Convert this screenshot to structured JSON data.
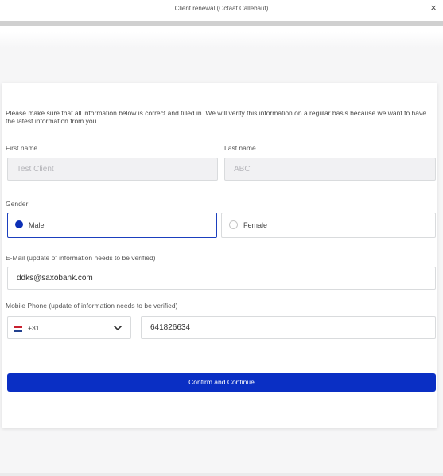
{
  "window": {
    "title": "Client renewal (Octaaf Callebaut)",
    "close_icon": "×"
  },
  "form": {
    "intro": "Please make sure that all information below is correct and filled in. We will verify this information on a regular basis because we want to have the latest information from you.",
    "first_name_label": "First name",
    "first_name_value": "Test Client",
    "last_name_label": "Last name",
    "last_name_value": "ABC",
    "gender_label": "Gender",
    "gender_options": [
      {
        "label": "Male",
        "selected": true
      },
      {
        "label": "Female",
        "selected": false
      }
    ],
    "email_label": "E-Mail (update of information needs to be verified)",
    "email_value": "ddks@saxobank.com",
    "phone_label": "Mobile Phone (update of information needs to be verified)",
    "phone_country_code": "+31",
    "phone_flag": "netherlands-flag-icon",
    "phone_number": "641826634",
    "confirm_label": "Confirm and Continue"
  },
  "colors": {
    "primary": "#0a2fc4",
    "selected_border": "#1b3fbe"
  }
}
